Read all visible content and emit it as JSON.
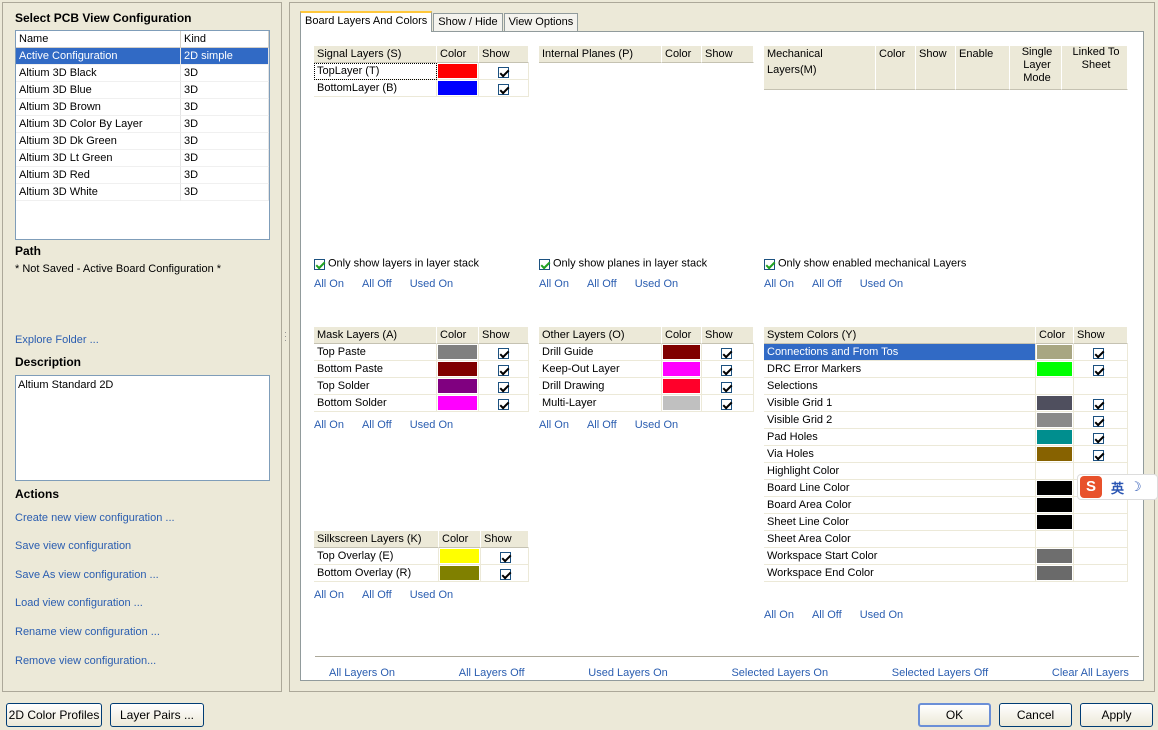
{
  "left": {
    "select_title": "Select PCB View Configuration",
    "list_headers": {
      "name": "Name",
      "kind": "Kind"
    },
    "configs": [
      {
        "name": "Active Configuration",
        "kind": "2D simple"
      },
      {
        "name": "Altium 3D Black",
        "kind": "3D"
      },
      {
        "name": "Altium 3D Blue",
        "kind": "3D"
      },
      {
        "name": "Altium 3D Brown",
        "kind": "3D"
      },
      {
        "name": "Altium 3D Color By Layer",
        "kind": "3D"
      },
      {
        "name": "Altium 3D Dk Green",
        "kind": "3D"
      },
      {
        "name": "Altium 3D Lt Green",
        "kind": "3D"
      },
      {
        "name": "Altium 3D Red",
        "kind": "3D"
      },
      {
        "name": "Altium 3D White",
        "kind": "3D"
      }
    ],
    "path_title": "Path",
    "path_value": "* Not Saved - Active Board Configuration *",
    "explore_folder": "Explore Folder ...",
    "description_title": "Description",
    "description_value": "Altium Standard 2D",
    "actions_title": "Actions",
    "actions": [
      "Create new view configuration ...",
      "Save view configuration",
      "Save As view configuration ...",
      "Load view configuration ...",
      "Rename view configuration ...",
      "Remove view configuration..."
    ]
  },
  "tabs": [
    "Board Layers And Colors",
    "Show / Hide",
    "View Options"
  ],
  "common": {
    "color": "Color",
    "show": "Show",
    "enable": "Enable",
    "all_on": "All On",
    "all_off": "All Off",
    "used_on": "Used On"
  },
  "signal": {
    "title": "Signal Layers (S)",
    "rows": [
      {
        "name": "TopLayer (T)",
        "color": "#ff0000",
        "show": true
      },
      {
        "name": "BottomLayer (B)",
        "color": "#0000ff",
        "show": true
      }
    ],
    "filter": "Only show layers in layer stack"
  },
  "planes": {
    "title": "Internal Planes (P)",
    "filter": "Only show planes in layer stack"
  },
  "mechanical": {
    "title": "Mechanical Layers(M)",
    "single_layer_mode": "Single Layer Mode",
    "linked_to_sheet": "Linked To Sheet",
    "filter": "Only show enabled mechanical Layers"
  },
  "mask": {
    "title": "Mask Layers (A)",
    "rows": [
      {
        "name": "Top Paste",
        "color": "#808080",
        "show": true
      },
      {
        "name": "Bottom Paste",
        "color": "#800000",
        "show": true
      },
      {
        "name": "Top Solder",
        "color": "#800080",
        "show": true
      },
      {
        "name": "Bottom Solder",
        "color": "#ff00ff",
        "show": true
      }
    ]
  },
  "other": {
    "title": "Other Layers (O)",
    "rows": [
      {
        "name": "Drill Guide",
        "color": "#800000",
        "show": true
      },
      {
        "name": "Keep-Out Layer",
        "color": "#ff00ff",
        "show": true
      },
      {
        "name": "Drill Drawing",
        "color": "#ff002a",
        "show": true
      },
      {
        "name": "Multi-Layer",
        "color": "#c0c0c0",
        "show": true
      }
    ]
  },
  "silk": {
    "title": "Silkscreen Layers (K)",
    "rows": [
      {
        "name": "Top Overlay (E)",
        "color": "#ffff00",
        "show": true
      },
      {
        "name": "Bottom Overlay (R)",
        "color": "#808000",
        "show": true
      }
    ]
  },
  "system": {
    "title": "System Colors (Y)",
    "rows": [
      {
        "name": "Connections and From Tos",
        "color": "#a8a682",
        "show": true
      },
      {
        "name": "DRC Error Markers",
        "color": "#00ff00",
        "show": true
      },
      {
        "name": "Selections",
        "color": "#ffffff",
        "show": null
      },
      {
        "name": "Visible Grid 1",
        "color": "#4f4f5e",
        "show": true
      },
      {
        "name": "Visible Grid 2",
        "color": "#8a8a8a",
        "show": true
      },
      {
        "name": "Pad Holes",
        "color": "#008e8e",
        "show": true
      },
      {
        "name": "Via Holes",
        "color": "#876200",
        "show": true
      },
      {
        "name": "Highlight Color",
        "color": "#ffffff",
        "show": null
      },
      {
        "name": "Board Line Color",
        "color": "#000000",
        "show": null
      },
      {
        "name": "Board Area Color",
        "color": "#000000",
        "show": null
      },
      {
        "name": "Sheet Line Color",
        "color": "#000000",
        "show": null
      },
      {
        "name": "Sheet Area Color",
        "color": "#ffffff",
        "show": null
      },
      {
        "name": "Workspace Start Color",
        "color": "#6e6e6e",
        "show": null
      },
      {
        "name": "Workspace End Color",
        "color": "#6a6a6a",
        "show": null
      }
    ]
  },
  "bottom_links": [
    "All Layers On",
    "All Layers Off",
    "Used Layers On",
    "Selected Layers On",
    "Selected Layers Off",
    "Clear All Layers"
  ],
  "buttons": {
    "color_profiles": "2D Color Profiles",
    "layer_pairs": "Layer Pairs ...",
    "ok": "OK",
    "cancel": "Cancel",
    "apply": "Apply"
  },
  "ime": {
    "logo": "S",
    "lang": "英",
    "mode": "☽"
  }
}
